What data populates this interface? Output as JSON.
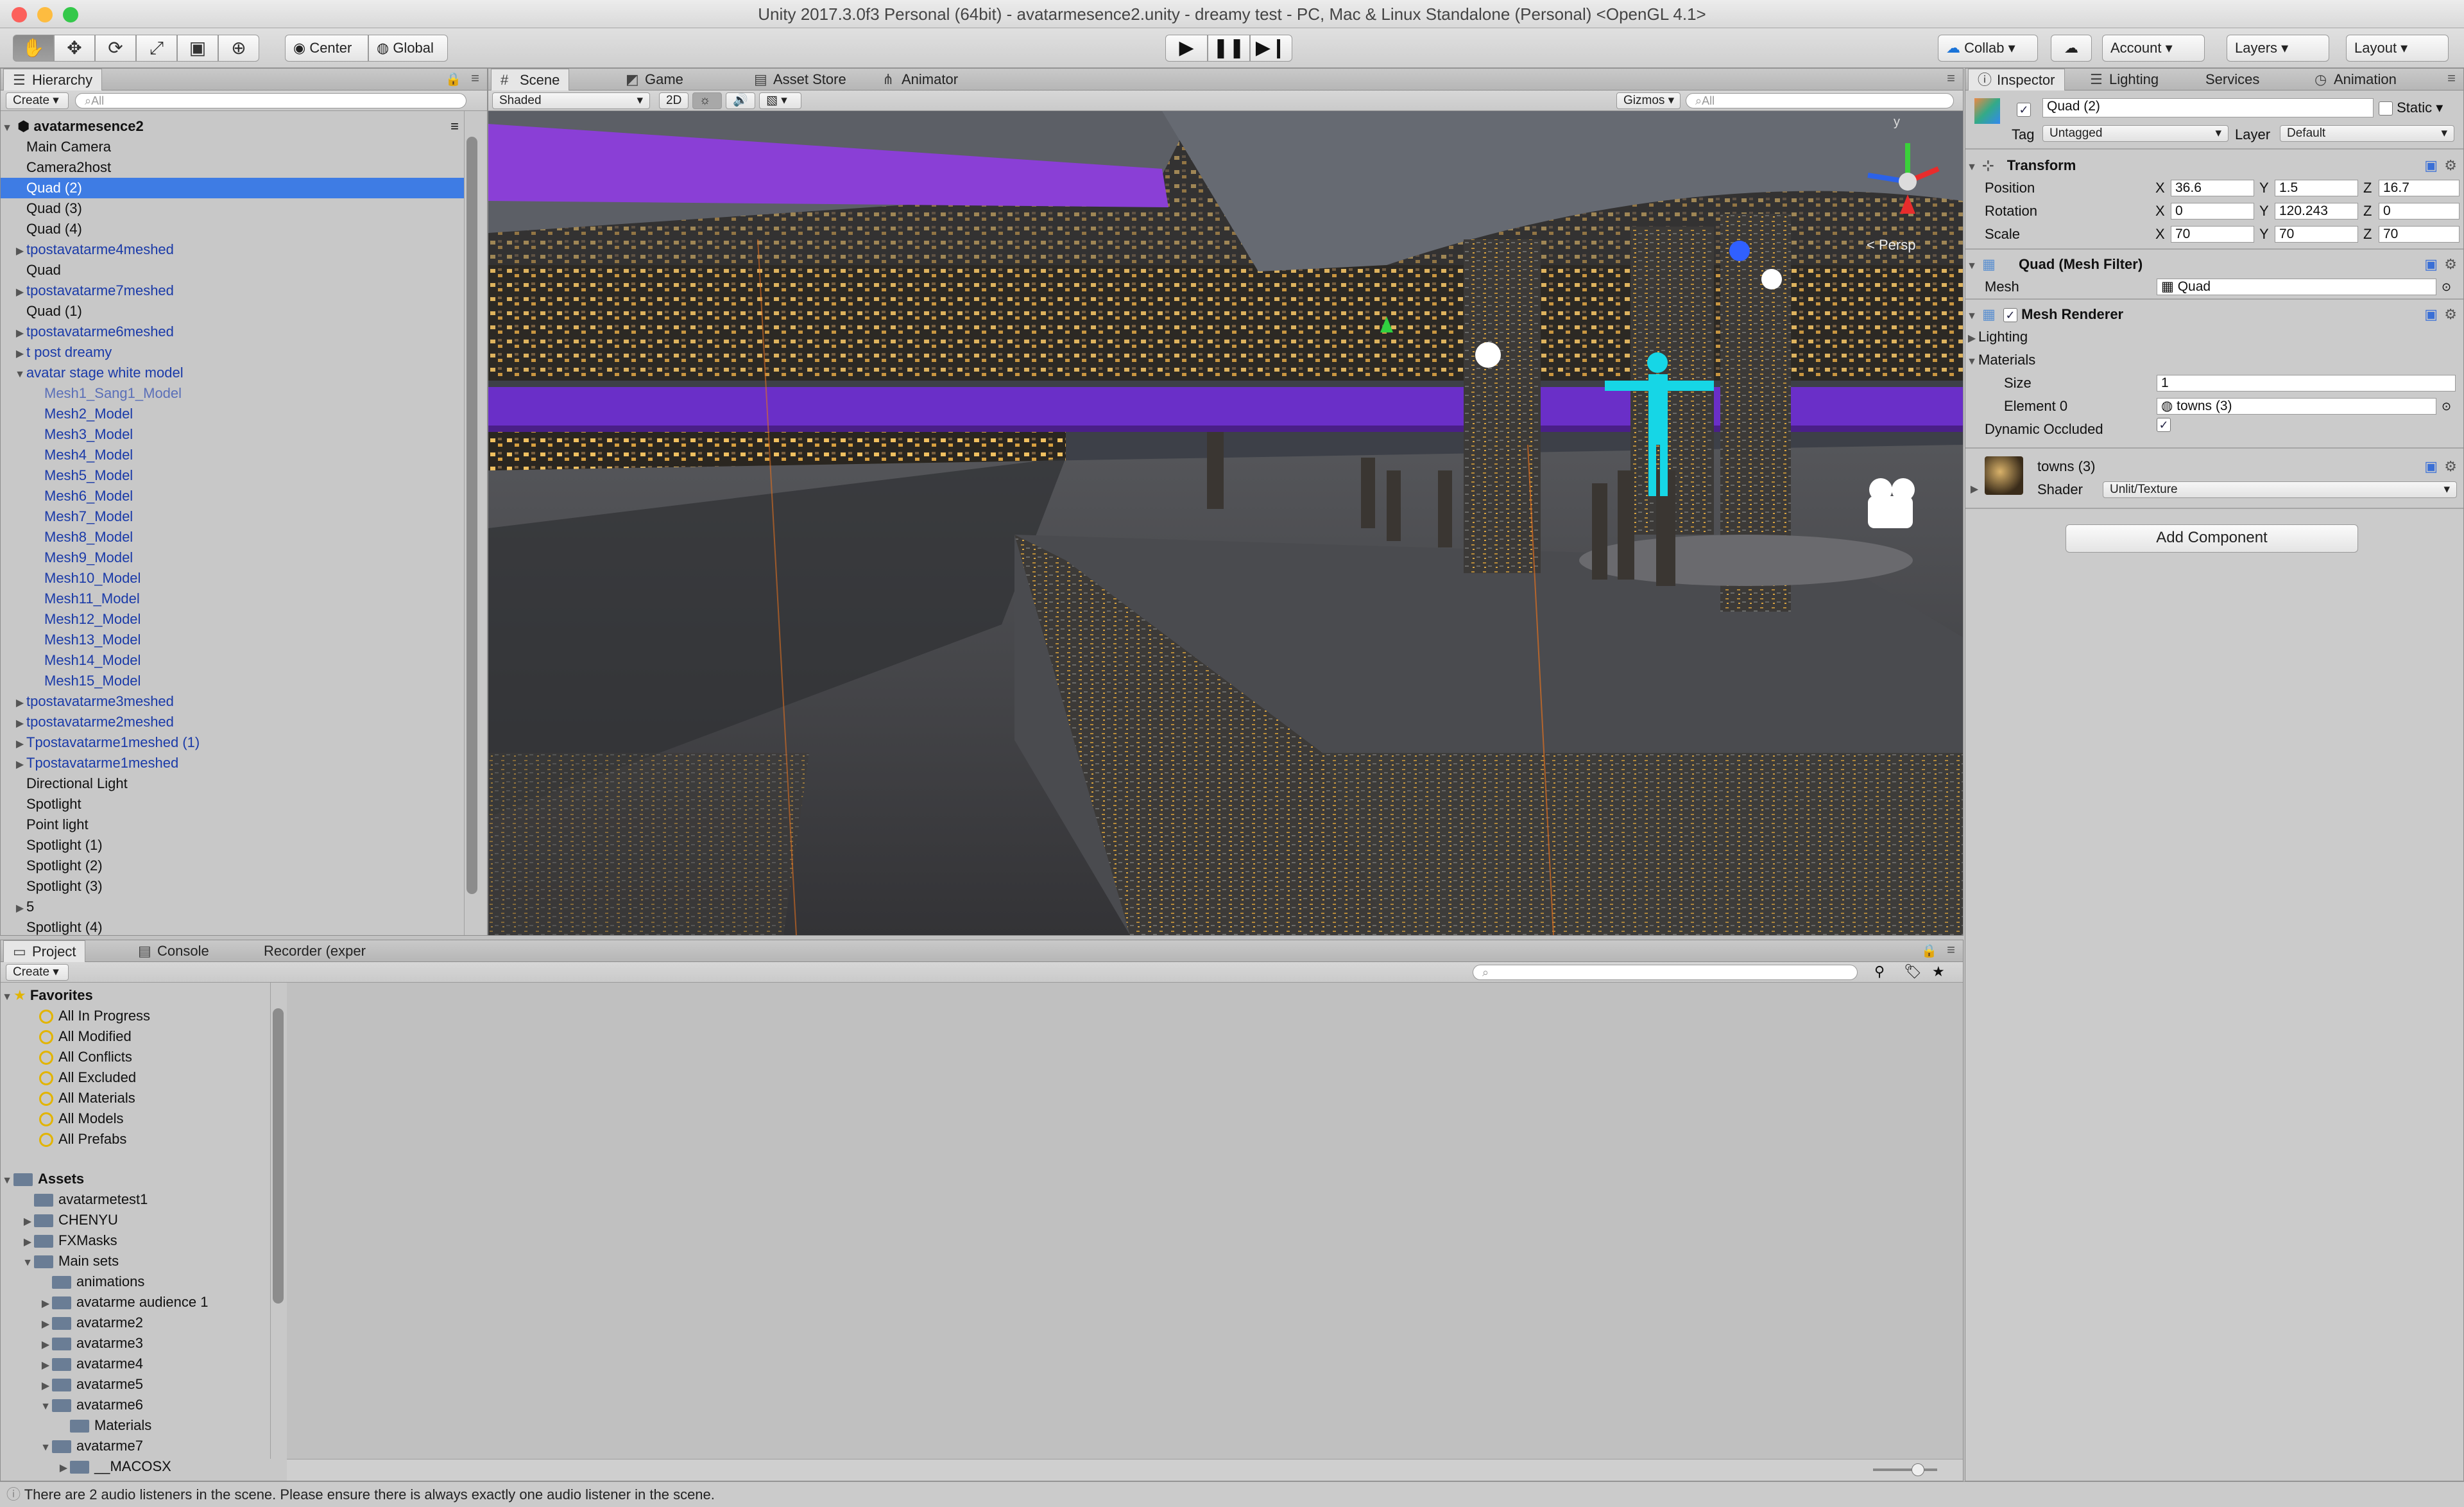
{
  "window": {
    "title": "Unity 2017.3.0f3 Personal (64bit) - avatarmesence2.unity - dreamy test - PC, Mac & Linux Standalone (Personal) <OpenGL 4.1>"
  },
  "toolbar": {
    "tools": [
      "hand-icon",
      "move-icon",
      "rotate-icon",
      "scale-icon",
      "rect-icon",
      "transform-icon"
    ],
    "pivot": "Center",
    "space": "Global",
    "collab": "Collab",
    "account": "Account",
    "layers": "Layers",
    "layout": "Layout"
  },
  "hierarchy": {
    "tab": "Hierarchy",
    "create": "Create",
    "search_placeholder": "All",
    "scene": "avatarmesence2",
    "items": [
      {
        "label": "Main Camera",
        "indent": 1,
        "kind": "normal",
        "arrow": ""
      },
      {
        "label": "Camera2host",
        "indent": 1,
        "kind": "normal",
        "arrow": ""
      },
      {
        "label": "Quad (2)",
        "indent": 1,
        "kind": "selected",
        "arrow": ""
      },
      {
        "label": "Quad (3)",
        "indent": 1,
        "kind": "normal",
        "arrow": ""
      },
      {
        "label": "Quad (4)",
        "indent": 1,
        "kind": "normal",
        "arrow": ""
      },
      {
        "label": "tpostavatarme4meshed",
        "indent": 1,
        "kind": "prefab",
        "arrow": "▶"
      },
      {
        "label": "Quad",
        "indent": 1,
        "kind": "normal",
        "arrow": ""
      },
      {
        "label": "tpostavatarme7meshed",
        "indent": 1,
        "kind": "prefab",
        "arrow": "▶"
      },
      {
        "label": "Quad (1)",
        "indent": 1,
        "kind": "normal",
        "arrow": ""
      },
      {
        "label": "tpostavatarme6meshed",
        "indent": 1,
        "kind": "prefab",
        "arrow": "▶"
      },
      {
        "label": "t post dreamy",
        "indent": 1,
        "kind": "prefab",
        "arrow": "▶"
      },
      {
        "label": "avatar stage white model",
        "indent": 1,
        "kind": "prefab",
        "arrow": "▼"
      },
      {
        "label": "Mesh1_Sang1_Model",
        "indent": 2,
        "kind": "prefab-dim",
        "arrow": ""
      },
      {
        "label": "Mesh2_Model",
        "indent": 2,
        "kind": "prefab",
        "arrow": ""
      },
      {
        "label": "Mesh3_Model",
        "indent": 2,
        "kind": "prefab",
        "arrow": ""
      },
      {
        "label": "Mesh4_Model",
        "indent": 2,
        "kind": "prefab",
        "arrow": ""
      },
      {
        "label": "Mesh5_Model",
        "indent": 2,
        "kind": "prefab",
        "arrow": ""
      },
      {
        "label": "Mesh6_Model",
        "indent": 2,
        "kind": "prefab",
        "arrow": ""
      },
      {
        "label": "Mesh7_Model",
        "indent": 2,
        "kind": "prefab",
        "arrow": ""
      },
      {
        "label": "Mesh8_Model",
        "indent": 2,
        "kind": "prefab",
        "arrow": ""
      },
      {
        "label": "Mesh9_Model",
        "indent": 2,
        "kind": "prefab",
        "arrow": ""
      },
      {
        "label": "Mesh10_Model",
        "indent": 2,
        "kind": "prefab",
        "arrow": ""
      },
      {
        "label": "Mesh11_Model",
        "indent": 2,
        "kind": "prefab",
        "arrow": ""
      },
      {
        "label": "Mesh12_Model",
        "indent": 2,
        "kind": "prefab",
        "arrow": ""
      },
      {
        "label": "Mesh13_Model",
        "indent": 2,
        "kind": "prefab",
        "arrow": ""
      },
      {
        "label": "Mesh14_Model",
        "indent": 2,
        "kind": "prefab",
        "arrow": ""
      },
      {
        "label": "Mesh15_Model",
        "indent": 2,
        "kind": "prefab",
        "arrow": ""
      },
      {
        "label": "tpostavatarme3meshed",
        "indent": 1,
        "kind": "prefab",
        "arrow": "▶"
      },
      {
        "label": "tpostavatarme2meshed",
        "indent": 1,
        "kind": "prefab",
        "arrow": "▶"
      },
      {
        "label": "Tpostavatarme1meshed (1)",
        "indent": 1,
        "kind": "prefab",
        "arrow": "▶"
      },
      {
        "label": "Tpostavatarme1meshed",
        "indent": 1,
        "kind": "prefab",
        "arrow": "▶"
      },
      {
        "label": "Directional Light",
        "indent": 1,
        "kind": "normal",
        "arrow": ""
      },
      {
        "label": "Spotlight",
        "indent": 1,
        "kind": "normal",
        "arrow": ""
      },
      {
        "label": "Point light",
        "indent": 1,
        "kind": "normal",
        "arrow": ""
      },
      {
        "label": "Spotlight (1)",
        "indent": 1,
        "kind": "normal",
        "arrow": ""
      },
      {
        "label": "Spotlight (2)",
        "indent": 1,
        "kind": "normal",
        "arrow": ""
      },
      {
        "label": "Spotlight (3)",
        "indent": 1,
        "kind": "normal",
        "arrow": ""
      },
      {
        "label": "5",
        "indent": 1,
        "kind": "normal",
        "arrow": "▶"
      },
      {
        "label": "Spotlight (4)",
        "indent": 1,
        "kind": "normal",
        "arrow": ""
      }
    ]
  },
  "scene_view": {
    "tabs": [
      "Scene",
      "Game",
      "Asset Store",
      "Animator"
    ],
    "shading": "Shaded",
    "mode2d": "2D",
    "gizmos": "Gizmos",
    "search_placeholder": "All",
    "persp_label": "< Persp",
    "axis_y": "y",
    "colors": {
      "sky": "#3a3f48",
      "stage": "#4b4b4f",
      "purple": "#7a38c8",
      "avatar": "#16d6e6"
    }
  },
  "project": {
    "tabs": [
      "Project",
      "Console",
      "Recorder (exper"
    ],
    "create": "Create",
    "favorites_label": "Favorites",
    "favorites": [
      "All In Progress",
      "All Modified",
      "All Conflicts",
      "All Excluded",
      "All Materials",
      "All Models",
      "All Prefabs"
    ],
    "assets_label": "Assets",
    "assets": [
      {
        "label": "avatarmetest1",
        "indent": 1,
        "arrow": ""
      },
      {
        "label": "CHENYU",
        "indent": 1,
        "arrow": "▶"
      },
      {
        "label": "FXMasks",
        "indent": 1,
        "arrow": "▶"
      },
      {
        "label": "Main sets",
        "indent": 1,
        "arrow": "▼"
      },
      {
        "label": "animations",
        "indent": 2,
        "arrow": ""
      },
      {
        "label": "avatarme audience 1",
        "indent": 2,
        "arrow": "▶"
      },
      {
        "label": "avatarme2",
        "indent": 2,
        "arrow": "▶"
      },
      {
        "label": "avatarme3",
        "indent": 2,
        "arrow": "▶"
      },
      {
        "label": "avatarme4",
        "indent": 2,
        "arrow": "▶"
      },
      {
        "label": "avatarme5",
        "indent": 2,
        "arrow": "▶"
      },
      {
        "label": "avatarme6",
        "indent": 2,
        "arrow": "▼"
      },
      {
        "label": "Materials",
        "indent": 3,
        "arrow": ""
      },
      {
        "label": "avatarme7",
        "indent": 2,
        "arrow": "▼"
      },
      {
        "label": "__MACOSX",
        "indent": 3,
        "arrow": "▶"
      }
    ]
  },
  "inspector": {
    "tabs": [
      "Inspector",
      "Lighting",
      "Services",
      "Animation"
    ],
    "object_name": "Quad (2)",
    "static_label": "Static",
    "tag_label": "Tag",
    "tag_value": "Untagged",
    "layer_label": "Layer",
    "layer_value": "Default",
    "transform": {
      "title": "Transform",
      "position_label": "Position",
      "rotation_label": "Rotation",
      "scale_label": "Scale",
      "position": {
        "x": "36.6",
        "y": "1.5",
        "z": "16.7"
      },
      "rotation": {
        "x": "0",
        "y": "120.243",
        "z": "0"
      },
      "scale": {
        "x": "70",
        "y": "70",
        "z": "70"
      }
    },
    "mesh_filter": {
      "title": "Quad (Mesh Filter)",
      "mesh_label": "Mesh",
      "mesh_value": "Quad"
    },
    "mesh_renderer": {
      "title": "Mesh Renderer",
      "lighting": "Lighting",
      "materials": "Materials",
      "size_label": "Size",
      "size_value": "1",
      "element0_label": "Element 0",
      "element0_value": "towns (3)",
      "occluded_label": "Dynamic Occluded"
    },
    "material": {
      "name": "towns (3)",
      "shader_label": "Shader",
      "shader_value": "Unlit/Texture"
    },
    "add_component": "Add Component"
  },
  "status": {
    "message": "There are 2 audio listeners in the scene. Please ensure there is always exactly one audio listener in the scene."
  }
}
